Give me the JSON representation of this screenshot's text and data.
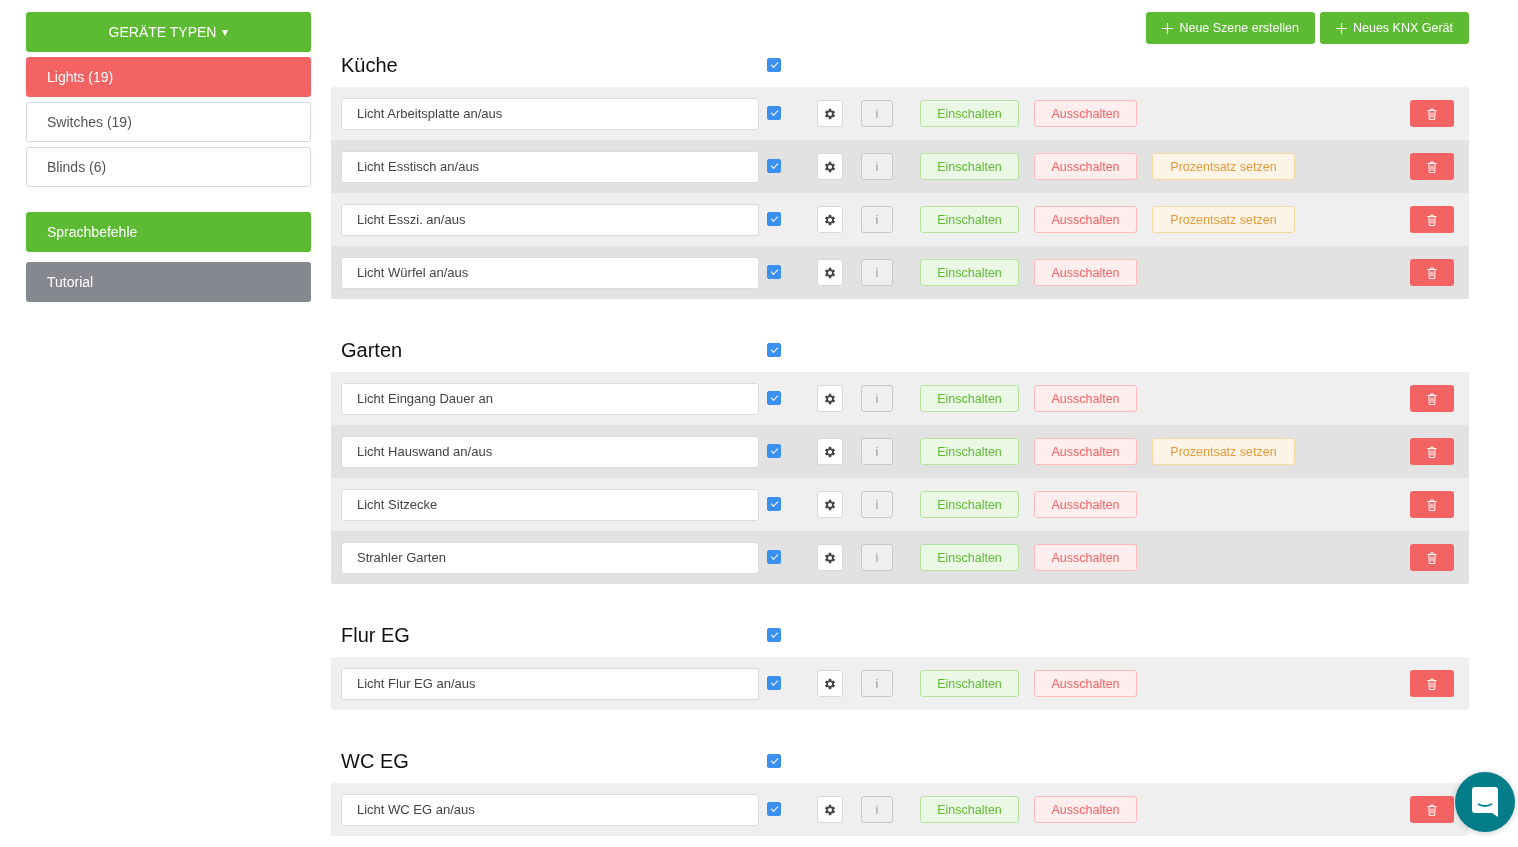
{
  "sidebar": {
    "dropdown": {
      "label": "GERÄTE TYPEN",
      "caret": "▾"
    },
    "items": [
      {
        "label": "Lights (19)",
        "selected": true
      },
      {
        "label": "Switches (19)",
        "selected": false
      },
      {
        "label": "Blinds (6)",
        "selected": false
      }
    ],
    "voice_button": "Sprachbefehle",
    "tutorial_button": "Tutorial"
  },
  "toolbar": [
    "Neue Szene erstellen",
    "Neues KNX Gerät"
  ],
  "groups": [
    {
      "title": "Küche",
      "checked": true,
      "rows": [
        {
          "name": "Licht Arbeitsplatte an/aus",
          "checked": true,
          "info": "i",
          "on": "Einschalten",
          "off": "Ausschalten"
        },
        {
          "name": "Licht Esstisch an/aus",
          "checked": true,
          "info": "i",
          "on": "Einschalten",
          "off": "Ausschalten",
          "percent": "Prozentsatz setzen"
        },
        {
          "name": "Licht Esszi. an/aus",
          "checked": true,
          "info": "i",
          "on": "Einschalten",
          "off": "Ausschalten",
          "percent": "Prozentsatz setzen"
        },
        {
          "name": "Licht Würfel an/aus",
          "checked": true,
          "info": "i",
          "on": "Einschalten",
          "off": "Ausschalten"
        }
      ]
    },
    {
      "title": "Garten",
      "checked": true,
      "rows": [
        {
          "name": "Licht Eingang Dauer an",
          "checked": true,
          "info": "i",
          "on": "Einschalten",
          "off": "Ausschalten"
        },
        {
          "name": "Licht Hauswand an/aus",
          "checked": true,
          "info": "i",
          "on": "Einschalten",
          "off": "Ausschalten",
          "percent": "Prozentsatz setzen"
        },
        {
          "name": "Licht Sitzecke",
          "checked": true,
          "info": "i",
          "on": "Einschalten",
          "off": "Ausschalten"
        },
        {
          "name": "Strahler Garten",
          "checked": true,
          "info": "i",
          "on": "Einschalten",
          "off": "Ausschalten"
        }
      ]
    },
    {
      "title": "Flur EG",
      "checked": true,
      "rows": [
        {
          "name": "Licht Flur EG an/aus",
          "checked": true,
          "info": "i",
          "on": "Einschalten",
          "off": "Ausschalten"
        }
      ]
    },
    {
      "title": "WC EG",
      "checked": true,
      "rows": [
        {
          "name": "Licht WC EG an/aus",
          "checked": true,
          "info": "i",
          "on": "Einschalten",
          "off": "Ausschalten"
        }
      ]
    }
  ]
}
